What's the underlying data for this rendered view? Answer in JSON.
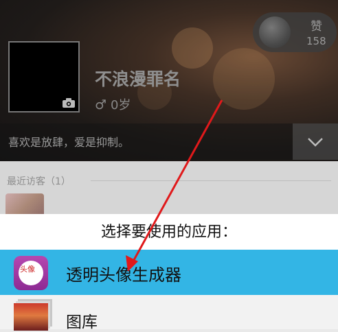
{
  "profile": {
    "name": "不浪漫罪名",
    "gender_symbol": "♂",
    "age": "0岁",
    "motto": "喜欢是放肆，爱是抑制。",
    "like_label": "赞",
    "like_count": "158"
  },
  "visitors": {
    "title": "最近访客（1）"
  },
  "chooser": {
    "title": "选择要使用的应用：",
    "options": [
      {
        "label": "透明头像生成器",
        "icon_text": "头像",
        "icon": "avatar-maker-icon"
      },
      {
        "label": "图库",
        "icon": "gallery-icon"
      }
    ]
  },
  "colors": {
    "selected_row": "#33b5e5",
    "arrow": "#e0191b"
  }
}
